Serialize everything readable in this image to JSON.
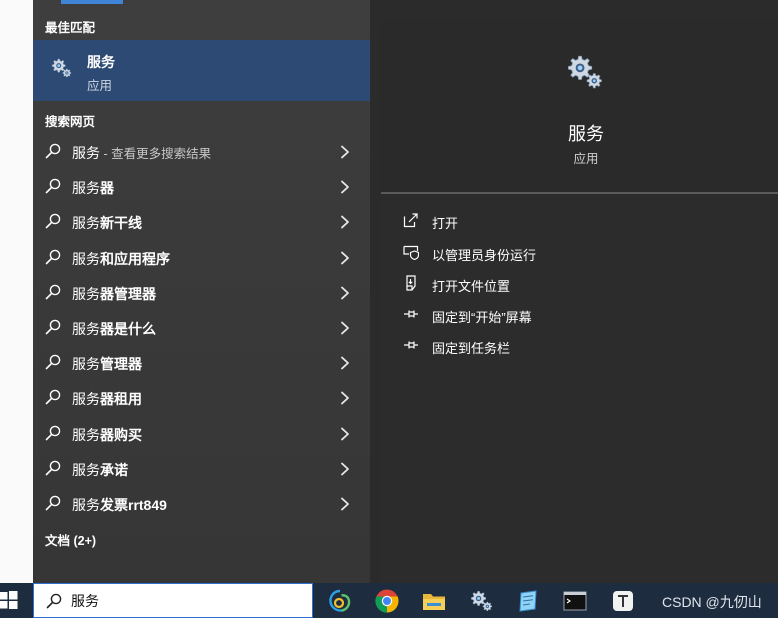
{
  "best_match": {
    "header": "最佳匹配",
    "title": "服务",
    "subtitle": "应用",
    "icon": "gears-icon"
  },
  "web_search": {
    "header": "搜索网页",
    "results": [
      {
        "prefix": "服务",
        "suffix": "",
        "hint": " - 查看更多搜索结果"
      },
      {
        "prefix": "服务",
        "suffix": "器",
        "hint": ""
      },
      {
        "prefix": "服务",
        "suffix": "新干线",
        "hint": ""
      },
      {
        "prefix": "服务",
        "suffix": "和应用程序",
        "hint": ""
      },
      {
        "prefix": "服务",
        "suffix": "器管理器",
        "hint": ""
      },
      {
        "prefix": "服务",
        "suffix": "器是什么",
        "hint": ""
      },
      {
        "prefix": "服务",
        "suffix": "管理器",
        "hint": ""
      },
      {
        "prefix": "服务",
        "suffix": "器租用",
        "hint": ""
      },
      {
        "prefix": "服务",
        "suffix": "器购买",
        "hint": ""
      },
      {
        "prefix": "服务",
        "suffix": "承诺",
        "hint": ""
      },
      {
        "prefix": "服务",
        "suffix": "发票rrt849",
        "hint": ""
      }
    ]
  },
  "documents": {
    "header": "文档 (2+)"
  },
  "preview": {
    "title": "服务",
    "subtitle": "应用",
    "actions": [
      {
        "label": "打开",
        "icon": "open-icon"
      },
      {
        "label": "以管理员身份运行",
        "icon": "shield-icon"
      },
      {
        "label": "打开文件位置",
        "icon": "file-location-icon"
      },
      {
        "label": "固定到“开始”屏幕",
        "icon": "pin-icon"
      },
      {
        "label": "固定到任务栏",
        "icon": "pin-icon"
      }
    ]
  },
  "taskbar": {
    "search_value": "服务",
    "apps": [
      "edge-beta-icon",
      "chrome-icon",
      "file-explorer-icon",
      "services-icon",
      "notes-icon",
      "terminal-icon",
      "typora-icon"
    ],
    "watermark": "CSDN @九仞山"
  },
  "colors": {
    "accent": "#3f84d6",
    "selected": "#2c4a74",
    "taskbar": "#1d2c3e"
  }
}
